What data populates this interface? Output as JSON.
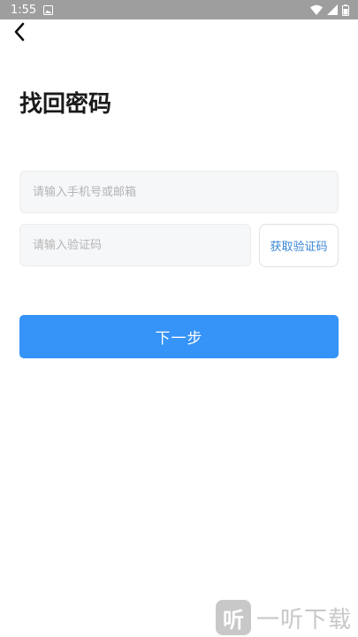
{
  "status_bar": {
    "time": "1:55",
    "notification_icon": "image-icon",
    "icons": [
      "wifi-icon",
      "signal-icon",
      "battery-icon"
    ],
    "background_color": "#9e9e9e"
  },
  "header": {
    "back_icon": "back-arrow-icon",
    "title": "找回密码"
  },
  "form": {
    "account_placeholder": "请输入手机号或邮箱",
    "account_value": "",
    "code_placeholder": "请输入验证码",
    "code_value": "",
    "get_code_label": "获取验证码",
    "submit_label": "下一步"
  },
  "watermark": {
    "logo_char": "听",
    "text": "一听下载"
  },
  "colors": {
    "primary": "#3693f7",
    "link": "#3a86d6",
    "input_background": "#f6f7f9",
    "title": "#1a1a1a"
  }
}
